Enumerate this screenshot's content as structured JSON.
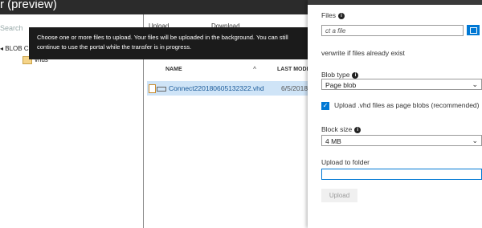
{
  "header": {
    "title": "r (preview)"
  },
  "left": {
    "search_placeholder": "Search",
    "tree": [
      {
        "label": "BLOB C"
      },
      {
        "label": "vhds"
      }
    ]
  },
  "toolbar": {
    "items": [
      "Upload",
      "Download"
    ]
  },
  "table": {
    "columns": [
      "NAME",
      "LAST MODIFIE"
    ],
    "sort_indicator": "^",
    "rows": [
      {
        "name": "Connect220180605132322.vhd",
        "date": "6/5/2018,"
      }
    ]
  },
  "tooltip": {
    "line1": "Choose one or more files to upload. Your files will be uploaded in the background. You can still",
    "line2": "continue to use the portal while the transfer is in progress."
  },
  "panel": {
    "files_label": "Files",
    "files_placeholder": "ct a file",
    "overwrite_label": "verwrite if files already exist",
    "blob_type_label": "Blob type",
    "blob_type_value": "Page blob",
    "upload_vhd_label": "Upload .vhd files as page blobs (recommended)",
    "block_size_label": "Block size",
    "block_size_value": "4 MB",
    "folder_label": "Upload to folder",
    "folder_value": "",
    "upload_button": "Upload"
  },
  "colors": {
    "accent": "#0078d4",
    "tooltip_bg": "#1b1b1b",
    "selected_row": "#cfe4f7"
  },
  "icons": [
    "info-icon",
    "folder-icon",
    "file-icon",
    "browse-folder-icon",
    "chevron-down-icon",
    "checkmark-icon"
  ]
}
